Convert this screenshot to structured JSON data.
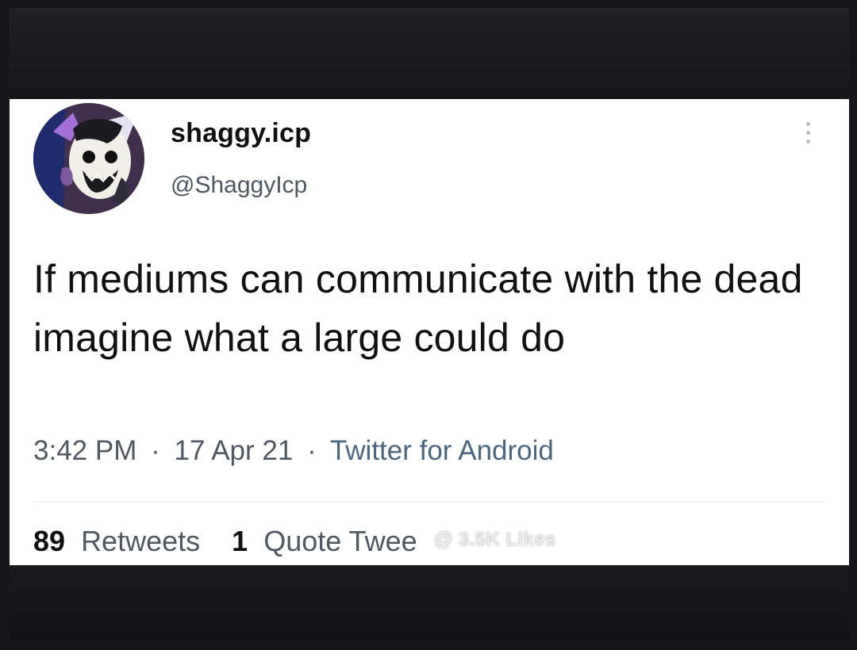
{
  "tweet": {
    "author": {
      "display_name": "shaggy.icp",
      "handle": "@ShaggyIcp",
      "avatar_icon": "clown-face-avatar"
    },
    "text": "If mediums can communicate with the dead imagine what a large could do",
    "timestamp": "3:42 PM",
    "date": "17 Apr 21",
    "separator": "·",
    "source": "Twitter for Android",
    "stats": {
      "retweets_count": "89",
      "retweets_label": "Retweets",
      "quotes_count": "1",
      "quotes_label": "Quote Twee"
    }
  },
  "watermark": {
    "text": "@ 3.5K Likes"
  },
  "colors": {
    "background": "#17171b",
    "card": "#ffffff",
    "text_primary": "#111111",
    "text_secondary": "#4f5964",
    "link": "#4a6680"
  }
}
